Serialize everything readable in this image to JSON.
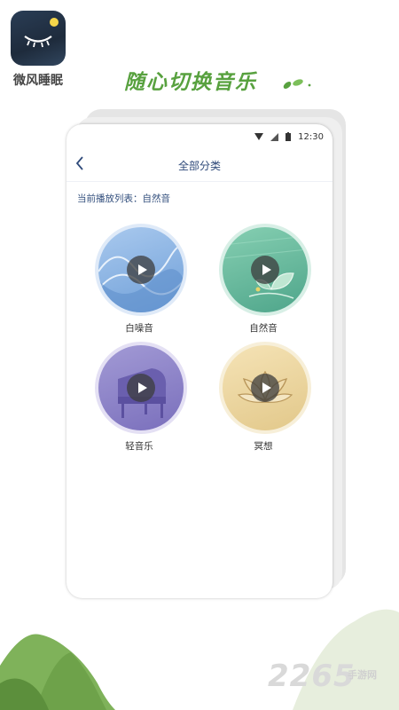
{
  "app": {
    "name": "微风睡眠"
  },
  "promo": {
    "headline": "随心切换音乐"
  },
  "status": {
    "time": "12:30"
  },
  "nav": {
    "title": "全部分类"
  },
  "current": {
    "label": "当前播放列表：自然音"
  },
  "categories": [
    {
      "label": "白噪音",
      "icon": "wave-icon"
    },
    {
      "label": "自然音",
      "icon": "leaf-icon"
    },
    {
      "label": "轻音乐",
      "icon": "piano-icon"
    },
    {
      "label": "冥想",
      "icon": "lotus-icon"
    }
  ],
  "watermark": {
    "brand": "2265",
    "sub": "手游网"
  },
  "colors": {
    "accent": "#58a13f",
    "nav": "#2f4a7a"
  }
}
